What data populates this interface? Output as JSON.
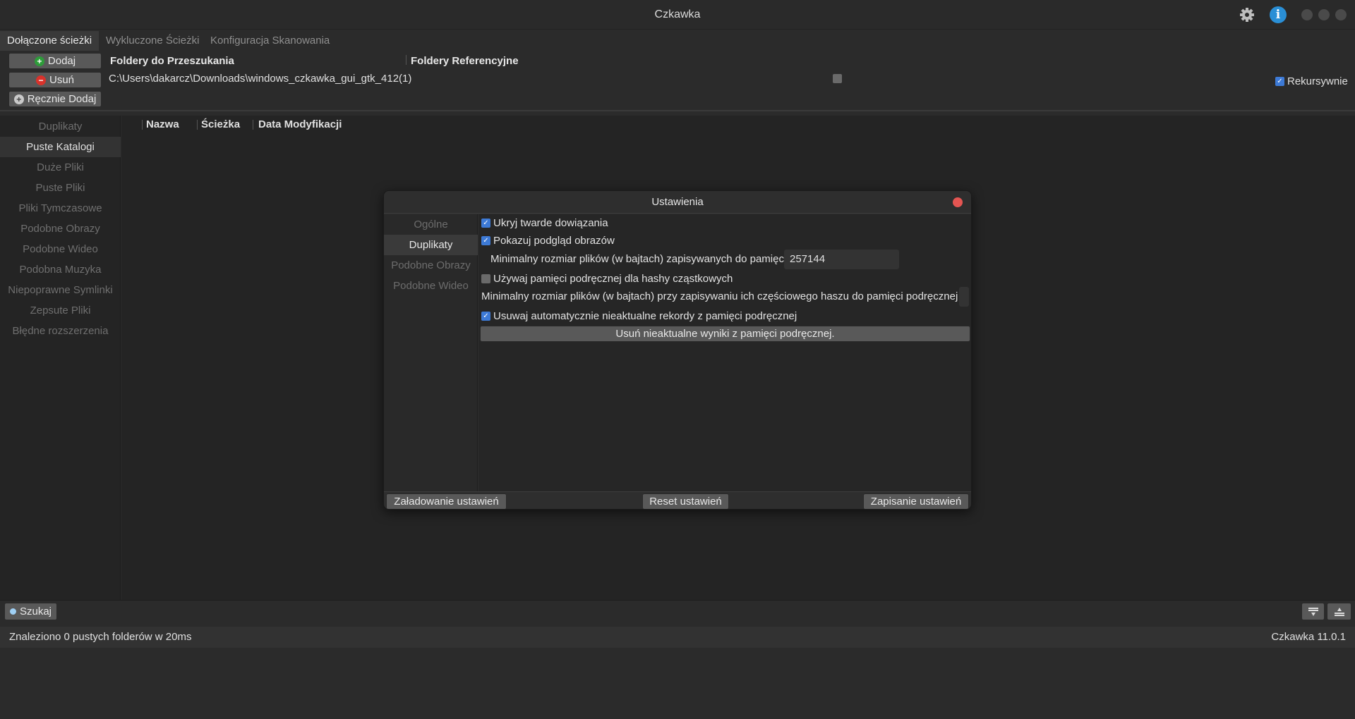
{
  "window": {
    "title": "Czkawka"
  },
  "tabs": [
    {
      "label": "Dołączone ścieżki"
    },
    {
      "label": "Wykluczone Ścieżki"
    },
    {
      "label": "Konfiguracja Skanowania"
    }
  ],
  "top_panel": {
    "add_label": "Dodaj",
    "remove_label": "Usuń",
    "manual_add_label": "Ręcznie Dodaj",
    "col_search": "Foldery do Przeszukania",
    "col_reference": "Foldery Referencyjne",
    "path": "C:\\Users\\dakarcz\\Downloads\\windows_czkawka_gui_gtk_412(1)",
    "recursive_label": "Rekursywnie",
    "recursive_checked": true,
    "reference_checked": false
  },
  "sidebar": {
    "items": [
      {
        "label": "Duplikaty"
      },
      {
        "label": "Puste Katalogi"
      },
      {
        "label": "Duże Pliki"
      },
      {
        "label": "Puste Pliki"
      },
      {
        "label": "Pliki Tymczasowe"
      },
      {
        "label": "Podobne Obrazy"
      },
      {
        "label": "Podobne Wideo"
      },
      {
        "label": "Podobna Muzyka"
      },
      {
        "label": "Niepoprawne Symlinki"
      },
      {
        "label": "Zepsute Pliki"
      },
      {
        "label": "Błędne rozszerzenia"
      }
    ],
    "active": "Puste Katalogi"
  },
  "results": {
    "columns": [
      "Nazwa",
      "Ścieżka",
      "Data Modyfikacji"
    ]
  },
  "dialog": {
    "title": "Ustawienia",
    "tabs": [
      {
        "label": "Ogólne"
      },
      {
        "label": "Duplikaty"
      },
      {
        "label": "Podobne Obrazy"
      },
      {
        "label": "Podobne Wideo"
      }
    ],
    "active_tab": "Duplikaty",
    "hide_hardlinks_label": "Ukryj twarde dowiązania",
    "show_preview_label": "Pokazuj podgląd obrazów",
    "min_cache_size_label": "Minimalny rozmiar plików (w bajtach) zapisywanych do pamięci podręcznej",
    "min_cache_size_value": "257144",
    "use_prehash_label": "Używaj pamięci podręcznej dla hashy cząstkowych",
    "min_prehash_size_label": "Minimalny rozmiar plików (w bajtach) przy zapisywaniu ich częściowego haszu do pamięci podręcznej",
    "min_prehash_size_value": "",
    "auto_remove_label": "Usuwaj automatycznie nieaktualne rekordy z pamięci podręcznej",
    "remove_outdated_button": "Usuń nieaktualne wyniki z pamięci podręcznej.",
    "load_button": "Załadowanie ustawień",
    "reset_button": "Reset ustawień",
    "save_button": "Zapisanie ustawień",
    "checks": {
      "hide_hardlinks": true,
      "show_preview": true,
      "use_prehash": false,
      "auto_remove": true
    }
  },
  "bottom": {
    "search_label": "Szukaj",
    "status_text": "Znaleziono 0 pustych folderów w 20ms",
    "version": "Czkawka 11.0.1"
  },
  "colors": {
    "accent_check": "#3d7ad6",
    "add_icon": "#2e9c3a",
    "remove_icon": "#d8322b",
    "info_icon": "#2a8fd6",
    "close_dot": "#e45552"
  }
}
